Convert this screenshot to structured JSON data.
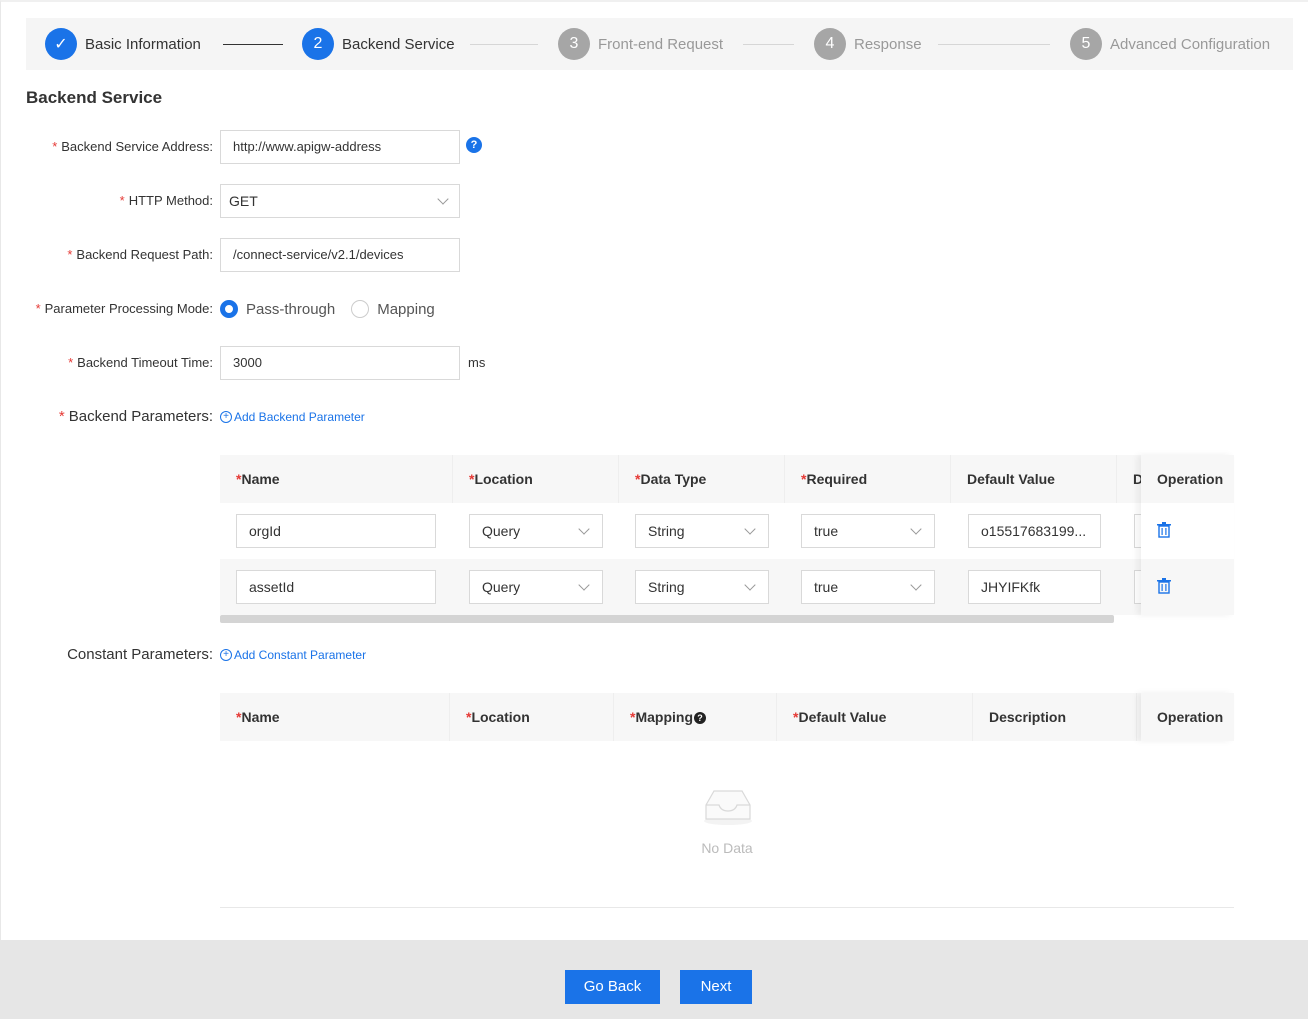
{
  "steps": [
    {
      "number": "✓",
      "label": "Basic Information"
    },
    {
      "number": "2",
      "label": "Backend Service"
    },
    {
      "number": "3",
      "label": "Front-end Request"
    },
    {
      "number": "4",
      "label": "Response"
    },
    {
      "number": "5",
      "label": "Advanced Configuration"
    }
  ],
  "section_title": "Backend Service",
  "form": {
    "address_label": "Backend Service Address:",
    "address_value": "http://www.apigw-address",
    "method_label": "HTTP Method:",
    "method_value": "GET",
    "path_label": "Backend Request Path:",
    "path_value": "/connect-service/v2.1/devices",
    "mode_label": "Parameter Processing Mode:",
    "mode_options": [
      "Pass-through",
      "Mapping"
    ],
    "timeout_label": "Backend Timeout Time:",
    "timeout_value": "3000",
    "timeout_unit": "ms",
    "help": "?"
  },
  "backend_params": {
    "label": "Backend Parameters:",
    "add_link": "Add Backend Parameter",
    "columns": [
      "Name",
      "Location",
      "Data Type",
      "Required",
      "Default Value",
      "D",
      "Operation"
    ],
    "rows": [
      {
        "name": "orgId",
        "location": "Query",
        "data_type": "String",
        "required": "true",
        "default_value": "o15517683199..."
      },
      {
        "name": "assetId",
        "location": "Query",
        "data_type": "String",
        "required": "true",
        "default_value": "JHYIFKfk"
      }
    ]
  },
  "constant_params": {
    "label": "Constant Parameters:",
    "add_link": "Add Constant Parameter",
    "columns": [
      "Name",
      "Location",
      "Mapping",
      "Default Value",
      "Description",
      "Operation"
    ],
    "empty_text": "No Data"
  },
  "footer": {
    "back_label": "Go Back",
    "next_label": "Next"
  },
  "colors": {
    "primary": "#1a73e8",
    "required": "#e53935"
  }
}
